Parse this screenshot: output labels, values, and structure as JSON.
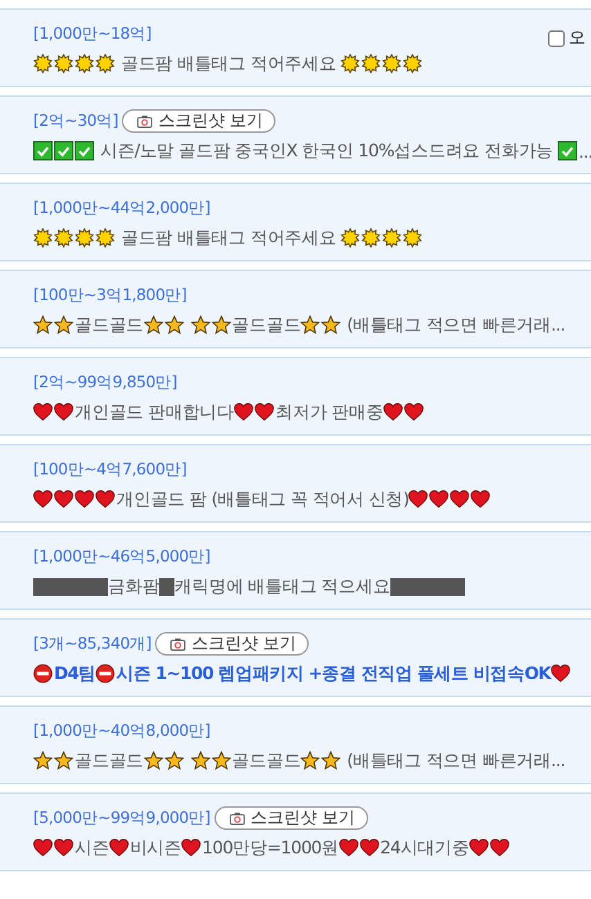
{
  "option_checkbox": {
    "label": "오",
    "checked": false
  },
  "listings": [
    {
      "price": "[1,000만~18억]",
      "emphasized": false,
      "title": [
        {
          "kind": "sun"
        },
        {
          "kind": "sun"
        },
        {
          "kind": "sun"
        },
        {
          "kind": "sun"
        },
        {
          "kind": "text",
          "text": " 골드팜 배틀태그 적어주세요 "
        },
        {
          "kind": "sun"
        },
        {
          "kind": "sun"
        },
        {
          "kind": "sun"
        },
        {
          "kind": "sun"
        }
      ]
    },
    {
      "price": "[2억~30억]",
      "screenshot_button": "스크린샷 보기",
      "emphasized": false,
      "title": [
        {
          "kind": "check"
        },
        {
          "kind": "check"
        },
        {
          "kind": "check"
        },
        {
          "kind": "text",
          "text": " 시즌/노말 골드팜 중국인X 한국인 10%섭스드려요 전화가능 "
        },
        {
          "kind": "check"
        },
        {
          "kind": "text",
          "text": "..."
        }
      ]
    },
    {
      "price": "[1,000만~44억2,000만]",
      "emphasized": false,
      "title": [
        {
          "kind": "sun"
        },
        {
          "kind": "sun"
        },
        {
          "kind": "sun"
        },
        {
          "kind": "sun"
        },
        {
          "kind": "text",
          "text": " 골드팜 배틀태그 적어주세요 "
        },
        {
          "kind": "sun"
        },
        {
          "kind": "sun"
        },
        {
          "kind": "sun"
        },
        {
          "kind": "sun"
        }
      ]
    },
    {
      "price": "[100만~3억1,800만]",
      "emphasized": false,
      "title": [
        {
          "kind": "star"
        },
        {
          "kind": "star"
        },
        {
          "kind": "text",
          "text": "골드골드"
        },
        {
          "kind": "star"
        },
        {
          "kind": "star"
        },
        {
          "kind": "gap"
        },
        {
          "kind": "star"
        },
        {
          "kind": "star"
        },
        {
          "kind": "text",
          "text": "골드골드"
        },
        {
          "kind": "star"
        },
        {
          "kind": "star"
        },
        {
          "kind": "text",
          "text": " (배틀태그 적으면 빠른거래..."
        }
      ]
    },
    {
      "price": "[2억~99억9,850만]",
      "emphasized": false,
      "title": [
        {
          "kind": "heart"
        },
        {
          "kind": "heart"
        },
        {
          "kind": "text",
          "text": "개인골드 판매합니다"
        },
        {
          "kind": "heart"
        },
        {
          "kind": "heart"
        },
        {
          "kind": "text",
          "text": "최저가 판매중"
        },
        {
          "kind": "heart"
        },
        {
          "kind": "heart"
        }
      ]
    },
    {
      "price": "[100만~4억7,600만]",
      "emphasized": false,
      "title": [
        {
          "kind": "heart"
        },
        {
          "kind": "heart"
        },
        {
          "kind": "heart"
        },
        {
          "kind": "heart"
        },
        {
          "kind": "text",
          "text": "개인골드 팜 (배틀태그 꼭 적어서 신청)"
        },
        {
          "kind": "heart"
        },
        {
          "kind": "heart"
        },
        {
          "kind": "heart"
        },
        {
          "kind": "heart"
        }
      ]
    },
    {
      "price": "[1,000만~46억5,000만]",
      "emphasized": false,
      "title": [
        {
          "kind": "redacted"
        },
        {
          "kind": "text",
          "text": "금화팜"
        },
        {
          "kind": "redacted-short"
        },
        {
          "kind": "text",
          "text": "캐릭명에 배틀태그 적으세요"
        },
        {
          "kind": "redacted"
        }
      ]
    },
    {
      "price": "[3개~85,340개]",
      "screenshot_button": "스크린샷 보기",
      "emphasized": true,
      "title": [
        {
          "kind": "no-entry"
        },
        {
          "kind": "text",
          "text": "D4팀"
        },
        {
          "kind": "no-entry"
        },
        {
          "kind": "text",
          "text": "시즌 1~100 렙업패키지 +종결 전직업 풀세트 비접속OK"
        },
        {
          "kind": "heart"
        }
      ]
    },
    {
      "price": "[1,000만~40억8,000만]",
      "emphasized": false,
      "title": [
        {
          "kind": "star"
        },
        {
          "kind": "star"
        },
        {
          "kind": "text",
          "text": "골드골드"
        },
        {
          "kind": "star"
        },
        {
          "kind": "star"
        },
        {
          "kind": "gap"
        },
        {
          "kind": "star"
        },
        {
          "kind": "star"
        },
        {
          "kind": "text",
          "text": "골드골드"
        },
        {
          "kind": "star"
        },
        {
          "kind": "star"
        },
        {
          "kind": "text",
          "text": " (배틀태그 적으면 빠른거래..."
        }
      ]
    },
    {
      "price": "[5,000만~99억9,000만]",
      "screenshot_button": "스크린샷 보기",
      "emphasized": false,
      "title": [
        {
          "kind": "heart"
        },
        {
          "kind": "heart"
        },
        {
          "kind": "text",
          "text": "시즌"
        },
        {
          "kind": "heart"
        },
        {
          "kind": "text",
          "text": "비시즌"
        },
        {
          "kind": "heart"
        },
        {
          "kind": "text",
          "text": "100만당=1000원"
        },
        {
          "kind": "heart"
        },
        {
          "kind": "heart"
        },
        {
          "kind": "text",
          "text": "24시대기중"
        },
        {
          "kind": "heart"
        },
        {
          "kind": "heart"
        }
      ]
    }
  ]
}
